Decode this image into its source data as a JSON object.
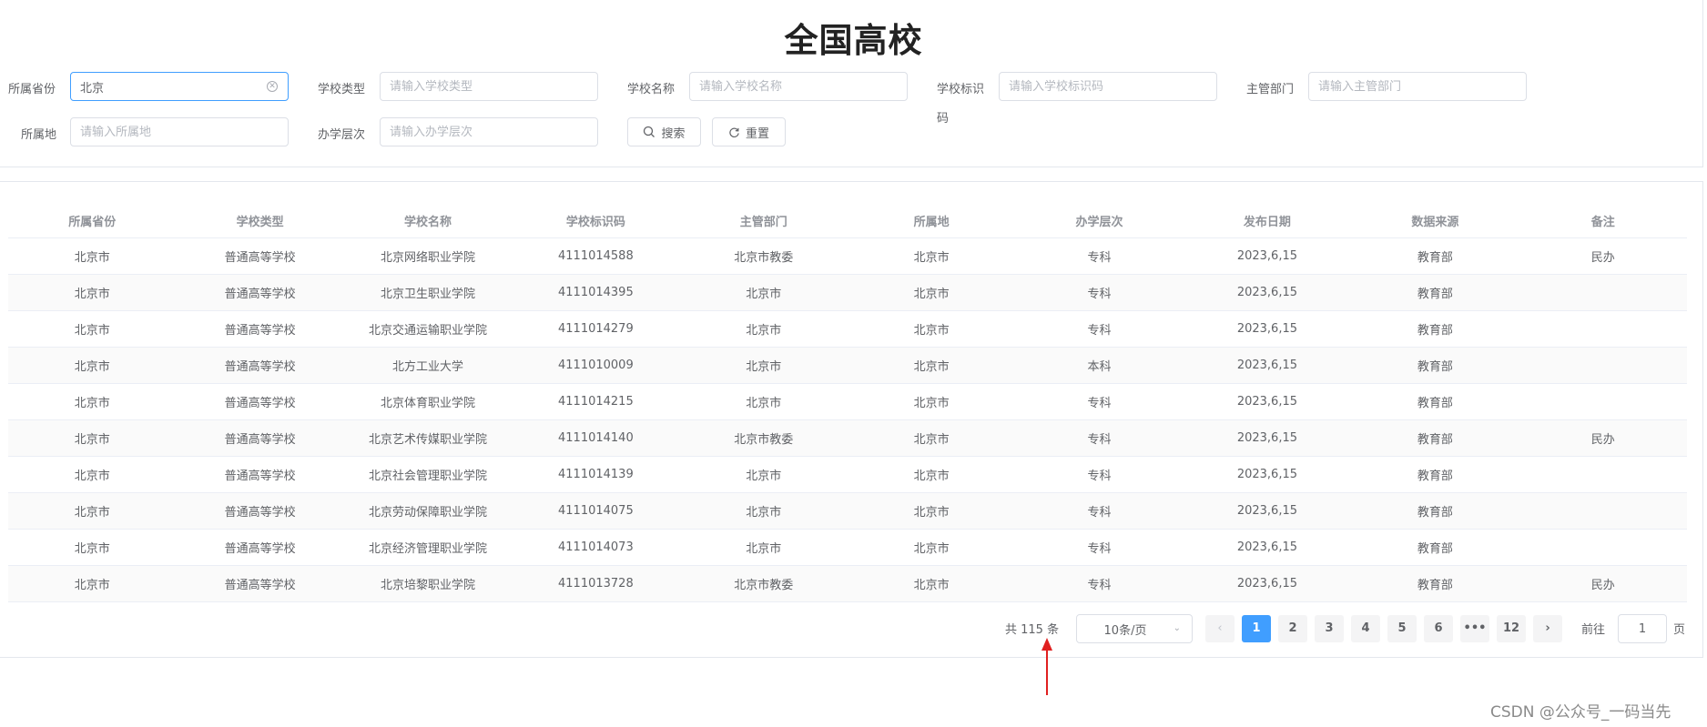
{
  "page": {
    "title": "全国高校"
  },
  "filters": {
    "province": {
      "label": "所属省份",
      "value": "北京",
      "placeholder": ""
    },
    "school_type": {
      "label": "学校类型",
      "placeholder": "请输入学校类型"
    },
    "school_name": {
      "label": "学校名称",
      "placeholder": "请输入学校名称"
    },
    "school_code": {
      "label_line1": "学校标识",
      "label_line2": "码",
      "placeholder": "请输入学校标识码"
    },
    "department": {
      "label": "主管部门",
      "placeholder": "请输入主管部门"
    },
    "location": {
      "label": "所属地",
      "placeholder": "请输入所属地"
    },
    "level": {
      "label": "办学层次",
      "placeholder": "请输入办学层次"
    },
    "search_button": "搜索",
    "reset_button": "重置",
    "clear_icon": "circle-close-icon",
    "search_icon": "search-icon",
    "reset_icon": "refresh-icon"
  },
  "table": {
    "columns": [
      "所属省份",
      "学校类型",
      "学校名称",
      "学校标识码",
      "主管部门",
      "所属地",
      "办学层次",
      "发布日期",
      "数据来源",
      "备注"
    ],
    "rows": [
      [
        "北京市",
        "普通高等学校",
        "北京网络职业学院",
        "4111014588",
        "北京市教委",
        "北京市",
        "专科",
        "2023,6,15",
        "教育部",
        "民办"
      ],
      [
        "北京市",
        "普通高等学校",
        "北京卫生职业学院",
        "4111014395",
        "北京市",
        "北京市",
        "专科",
        "2023,6,15",
        "教育部",
        ""
      ],
      [
        "北京市",
        "普通高等学校",
        "北京交通运输职业学院",
        "4111014279",
        "北京市",
        "北京市",
        "专科",
        "2023,6,15",
        "教育部",
        ""
      ],
      [
        "北京市",
        "普通高等学校",
        "北方工业大学",
        "4111010009",
        "北京市",
        "北京市",
        "本科",
        "2023,6,15",
        "教育部",
        ""
      ],
      [
        "北京市",
        "普通高等学校",
        "北京体育职业学院",
        "4111014215",
        "北京市",
        "北京市",
        "专科",
        "2023,6,15",
        "教育部",
        ""
      ],
      [
        "北京市",
        "普通高等学校",
        "北京艺术传媒职业学院",
        "4111014140",
        "北京市教委",
        "北京市",
        "专科",
        "2023,6,15",
        "教育部",
        "民办"
      ],
      [
        "北京市",
        "普通高等学校",
        "北京社会管理职业学院",
        "4111014139",
        "北京市",
        "北京市",
        "专科",
        "2023,6,15",
        "教育部",
        ""
      ],
      [
        "北京市",
        "普通高等学校",
        "北京劳动保障职业学院",
        "4111014075",
        "北京市",
        "北京市",
        "专科",
        "2023,6,15",
        "教育部",
        ""
      ],
      [
        "北京市",
        "普通高等学校",
        "北京经济管理职业学院",
        "4111014073",
        "北京市",
        "北京市",
        "专科",
        "2023,6,15",
        "教育部",
        ""
      ],
      [
        "北京市",
        "普通高等学校",
        "北京培黎职业学院",
        "4111013728",
        "北京市教委",
        "北京市",
        "专科",
        "2023,6,15",
        "教育部",
        "民办"
      ]
    ]
  },
  "pagination": {
    "total_text": "共 115 条",
    "page_size": "10条/页",
    "pages": [
      "1",
      "2",
      "3",
      "4",
      "5",
      "6",
      "•••",
      "12"
    ],
    "current_page": "1",
    "prev_icon": "chevron-left-icon",
    "next_icon": "chevron-right-icon",
    "goto_label": "前往",
    "goto_value": "1",
    "goto_unit": "页"
  },
  "annotation": {
    "arrow_color": "#e02020",
    "arrow_icon": "red-arrow-icon"
  },
  "watermark": "CSDN @公众号_一码当先",
  "colors": {
    "primary": "#409eff",
    "border": "#dcdfe6",
    "stripe": "#fafafa"
  }
}
